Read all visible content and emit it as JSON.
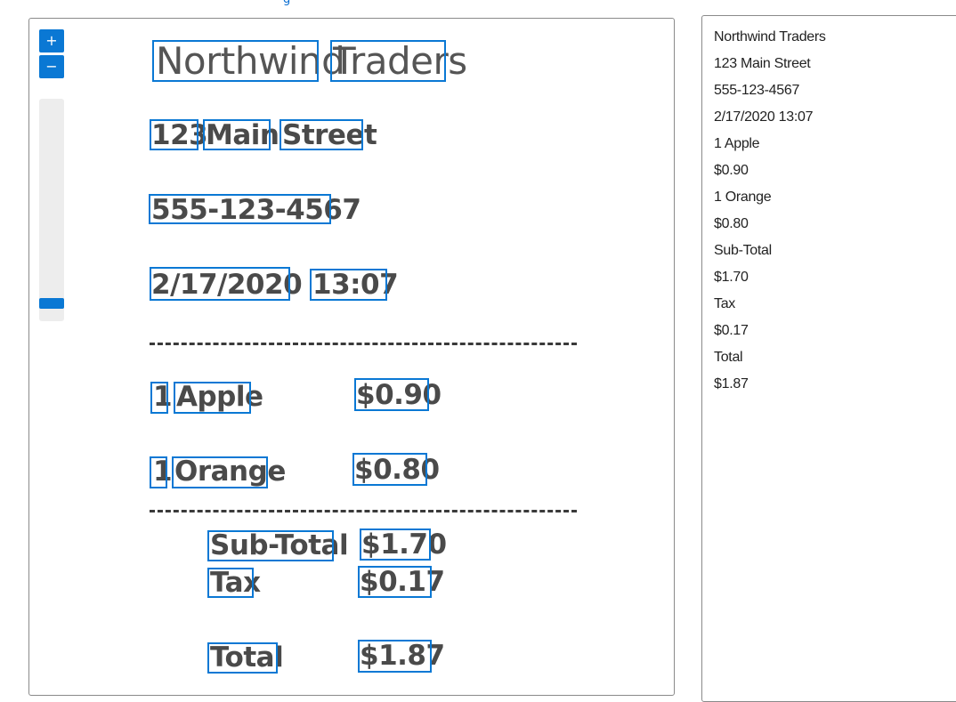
{
  "top_link_fragment": "g",
  "viewer": {
    "zoom_in_label": "+",
    "zoom_out_label": "−",
    "receipt": {
      "title_words": [
        "Northwind",
        "Traders"
      ],
      "address_words": [
        "123",
        "Main",
        "Street"
      ],
      "phone": "555-123-4567",
      "date": "2/17/2020",
      "time": "13:07",
      "items": [
        {
          "qty": "1",
          "name": "Apple",
          "price": "$0.90"
        },
        {
          "qty": "1",
          "name": "Orange",
          "price": "$0.80"
        }
      ],
      "subtotal_label": "Sub-Total",
      "subtotal_value": "$1.70",
      "tax_label": "Tax",
      "tax_value": "$0.17",
      "total_label": "Total",
      "total_value": "$1.87"
    }
  },
  "results_panel": {
    "lines": [
      "Northwind Traders",
      "123 Main Street",
      "555-123-4567",
      "2/17/2020 13:07",
      "1 Apple",
      "$0.90",
      "1 Orange",
      "$0.80",
      "Sub-Total",
      "$1.70",
      "Tax",
      "$0.17",
      "Total",
      "$1.87"
    ]
  },
  "colors": {
    "accent": "#0a78d4",
    "receipt_text": "#4a4a4a",
    "border": "#8a8a8a"
  }
}
